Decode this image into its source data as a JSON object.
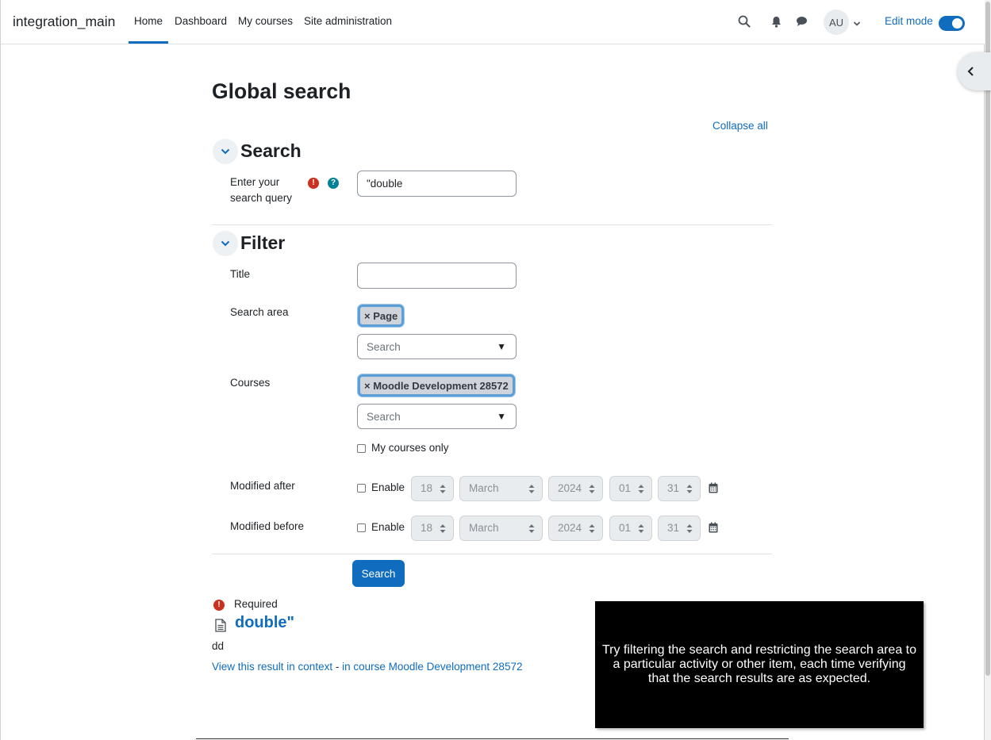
{
  "navbar": {
    "brand": "integration_main",
    "links": [
      "Home",
      "Dashboard",
      "My courses",
      "Site administration"
    ],
    "user_initials": "AU",
    "edit_mode_label": "Edit mode",
    "icons": [
      "search-icon",
      "bell-icon",
      "chat-icon",
      "chevron-down-icon"
    ],
    "accent_color": "#0f6cbf"
  },
  "page": {
    "title": "Global search",
    "collapse_all": "Collapse all"
  },
  "search_section": {
    "title": "Search",
    "query_label_line1": "Enter your",
    "query_label_line2": "search query",
    "query_value": "\"double"
  },
  "filter_section": {
    "title": "Filter",
    "title_label": "Title",
    "title_value": "",
    "search_area_label": "Search area",
    "search_area_tag": "× Page",
    "search_area_placeholder": "Search",
    "courses_label": "Courses",
    "courses_tag": "× Moodle Development 28572",
    "courses_placeholder": "Search",
    "my_courses_only": "My courses only",
    "modified_after_label": "Modified after",
    "modified_before_label": "Modified before",
    "enable_label": "Enable",
    "date": {
      "day": "18",
      "month": "March",
      "year": "2024",
      "hour": "01",
      "minute": "31"
    }
  },
  "submit_label": "Search",
  "required_label": "Required",
  "result": {
    "title": "double\"",
    "body": "dd",
    "context_link": "View this result in context",
    "separator": " - ",
    "course_link": "in course Moodle Development 28572"
  },
  "caption": "Try filtering the search and restricting the search area to a particular activity or other item, each time verifying that the search results are as expected."
}
